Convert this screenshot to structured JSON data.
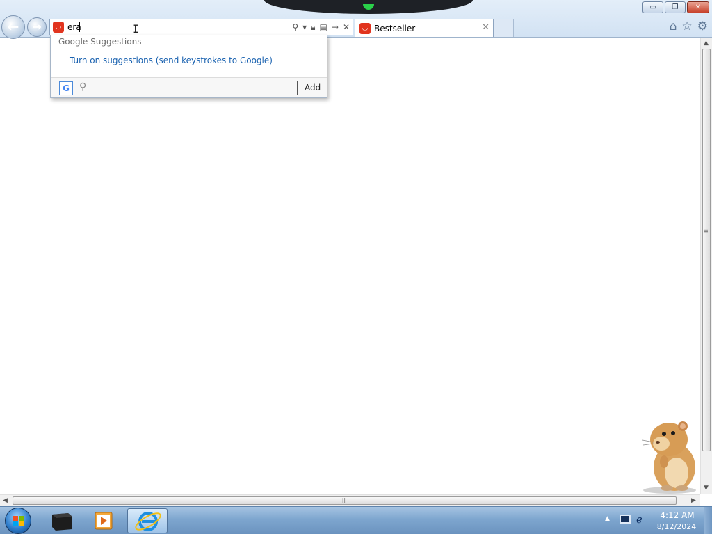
{
  "window": {
    "buttons": {
      "minimize": "▭",
      "restore": "❐",
      "close": "✕"
    }
  },
  "nav": {
    "back_icon": "←",
    "forward_icon": "→"
  },
  "address_bar": {
    "value": "era",
    "tool_icons": [
      "search-icon",
      "dropdown-arrow-icon",
      "lock-icon",
      "compat-icon",
      "go-icon",
      "stop-icon"
    ]
  },
  "tabs": [
    {
      "label": "Bestseller",
      "close": "✕",
      "active": true
    }
  ],
  "toolbar_icons": [
    "home-icon",
    "favorites-icon",
    "tools-gear-icon"
  ],
  "dropdown": {
    "header": "Google Suggestions",
    "suggestion_link": "Turn on suggestions (send keystrokes to Google)",
    "provider_letter": "G",
    "add_label": "Add"
  },
  "colors": {
    "accent_red": "#e1341e",
    "link_blue": "#1a62b0",
    "taskbar": "#7ea6cf"
  },
  "taskbar": {
    "items": [
      {
        "name": "start-button"
      },
      {
        "name": "taskbar-app-dark-box"
      },
      {
        "name": "taskbar-media-player"
      },
      {
        "name": "taskbar-internet-explorer",
        "active": true
      }
    ],
    "clock": {
      "time": "4:12 AM",
      "date": "8/12/2024"
    }
  }
}
